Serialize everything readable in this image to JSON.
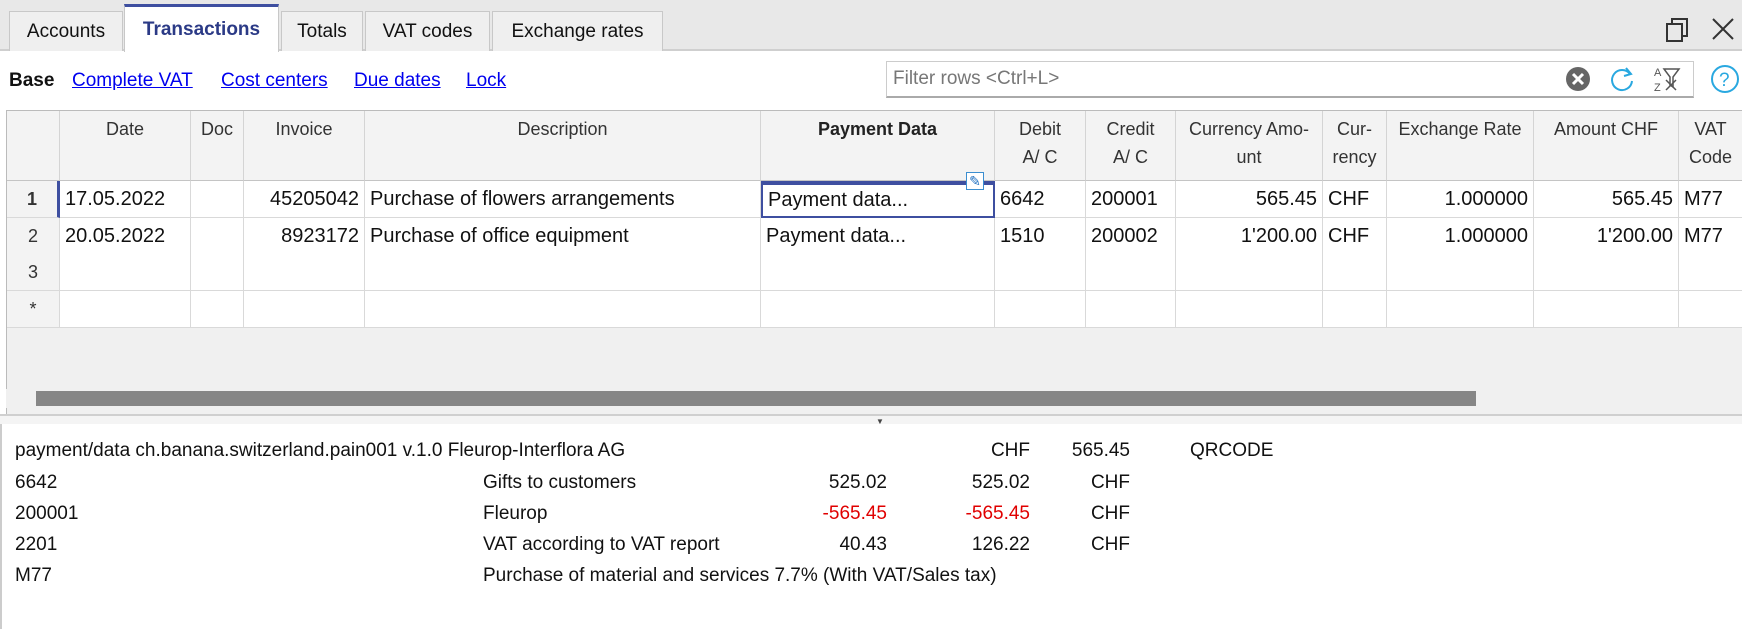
{
  "tabs": [
    {
      "label": "Accounts"
    },
    {
      "label": "Transactions",
      "active": true
    },
    {
      "label": "Totals"
    },
    {
      "label": "VAT codes"
    },
    {
      "label": "Exchange rates"
    }
  ],
  "window_icons": {
    "restore": "restore-window-icon",
    "close": "close-icon"
  },
  "views": {
    "active": "Base",
    "links": [
      "Complete VAT",
      "Cost centers",
      "Due dates",
      "Lock"
    ]
  },
  "filter": {
    "placeholder": "Filter rows <Ctrl+L>",
    "value": ""
  },
  "columns": [
    "Date",
    "Doc",
    "Invoice",
    "Description",
    "Payment Data",
    "Debit A/ C",
    "Credit A/ C",
    "Currency Amo- unt",
    "Cur- rency",
    "Exchange Rate",
    "Amount CHF",
    "VAT Code"
  ],
  "rows": [
    {
      "num": "1",
      "date": "17.05.2022",
      "doc": "",
      "invoice": "45205042",
      "description": "Purchase of flowers arrangements",
      "payment": "Payment data...",
      "debit": "6642",
      "credit": "200001",
      "cur_amount": "565.45",
      "currency": "CHF",
      "rate": "1.000000",
      "amount_chf": "565.45",
      "vat": "M77"
    },
    {
      "num": "2",
      "date": "20.05.2022",
      "doc": "",
      "invoice": "8923172",
      "description": "Purchase of office equipment",
      "payment": "Payment data...",
      "debit": "1510",
      "credit": "200002",
      "cur_amount": "1'200.00",
      "currency": "CHF",
      "rate": "1.000000",
      "amount_chf": "1'200.00",
      "vat": "M77"
    },
    {
      "num": "3"
    },
    {
      "num": "*"
    }
  ],
  "info": {
    "header": {
      "left": "payment/data ch.banana.switzerland.pain001 v.1.0 Fleurop-Interflora AG",
      "currency": "CHF",
      "amount": "565.45",
      "type": "QRCODE"
    },
    "lines": [
      {
        "code": "6642",
        "desc": "Gifts to customers",
        "a": "525.02",
        "b": "525.02",
        "cur": "CHF"
      },
      {
        "code": "200001",
        "desc": "Fleurop",
        "a": "-565.45",
        "b": "-565.45",
        "cur": "CHF",
        "negative": true
      },
      {
        "code": "2201",
        "desc": "VAT according to VAT report",
        "a": "40.43",
        "b": "126.22",
        "cur": "CHF"
      },
      {
        "code": "M77",
        "desc": "Purchase of material and services 7.7% (With VAT/Sales tax)"
      }
    ]
  },
  "colors": {
    "accent": "#3e4fa0",
    "link": "#0000ee",
    "negative": "#e00000"
  }
}
